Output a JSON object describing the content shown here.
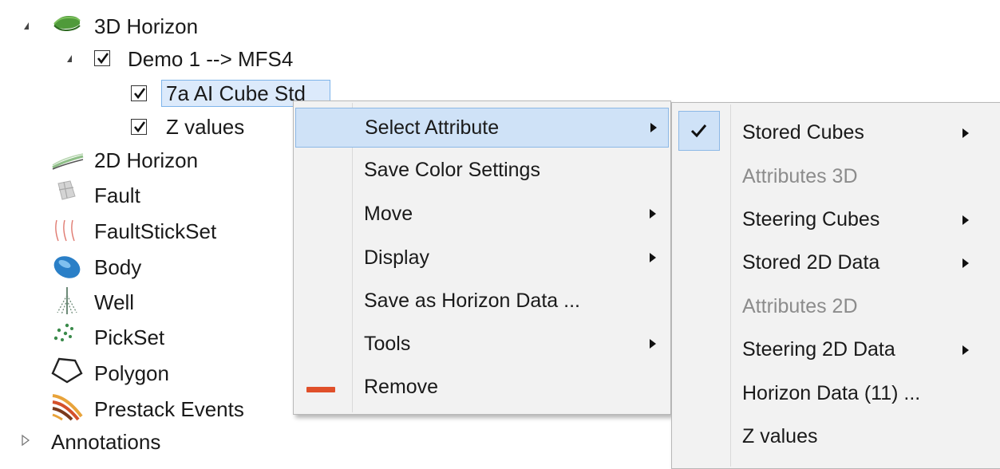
{
  "tree": {
    "root_label": "3D Horizon",
    "child": {
      "label": "Demo 1 --> MFS4",
      "checked": true,
      "items": [
        {
          "label": "7a AI Cube Std",
          "checked": true,
          "selected": true
        },
        {
          "label": "Z values",
          "checked": true
        }
      ]
    },
    "items": [
      {
        "label": "2D Horizon",
        "icon": "2d-horizon-icon"
      },
      {
        "label": "Fault",
        "icon": "fault-icon"
      },
      {
        "label": "FaultStickSet",
        "icon": "faultstickset-icon"
      },
      {
        "label": "Body",
        "icon": "body-icon"
      },
      {
        "label": "Well",
        "icon": "well-icon"
      },
      {
        "label": "PickSet",
        "icon": "pickset-icon"
      },
      {
        "label": "Polygon",
        "icon": "polygon-icon"
      },
      {
        "label": "Prestack Events",
        "icon": "prestack-events-icon"
      }
    ],
    "annotations_label": "Annotations"
  },
  "context_menu": {
    "items": [
      {
        "label": "Select Attribute",
        "submenu": true,
        "highlighted": true
      },
      {
        "label": "Save Color Settings",
        "submenu": false
      },
      {
        "label": "Move",
        "submenu": true
      },
      {
        "label": "Display",
        "submenu": true
      },
      {
        "label": "Save as Horizon Data ...",
        "submenu": false
      },
      {
        "label": "Tools",
        "submenu": true
      },
      {
        "label": "Remove",
        "submenu": false,
        "icon": "remove-icon"
      }
    ]
  },
  "submenu": {
    "items": [
      {
        "label": "Stored Cubes",
        "submenu": true,
        "checked": true,
        "enabled": true
      },
      {
        "label": "Attributes 3D",
        "submenu": false,
        "enabled": false
      },
      {
        "label": "Steering Cubes",
        "submenu": true,
        "enabled": true
      },
      {
        "label": "Stored 2D Data",
        "submenu": true,
        "enabled": true
      },
      {
        "label": "Attributes 2D",
        "submenu": false,
        "enabled": false
      },
      {
        "label": "Steering 2D Data",
        "submenu": true,
        "enabled": true
      },
      {
        "label": "Horizon Data (11) ...",
        "submenu": false,
        "enabled": true
      },
      {
        "label": "Z values",
        "submenu": false,
        "enabled": true
      }
    ]
  },
  "colors": {
    "highlight": "#cfe2f7",
    "selection": "#dceafb",
    "remove": "#e0502a",
    "horizon_green": "#4f9a3a",
    "body_blue": "#2a7fc7"
  }
}
